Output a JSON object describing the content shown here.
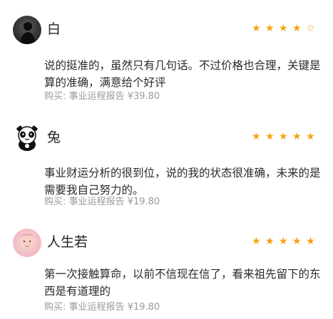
{
  "reviews": [
    {
      "username": "白",
      "rating": 4,
      "text": "说的挺准的，虽然只有几句话。不过价格也合理，关键是算的准确，满意给个好评",
      "purchase_label": "购买:",
      "product": "事业运程报告",
      "price": "¥39.80",
      "avatar_icon": "person-silhouette-avatar"
    },
    {
      "username": "兔",
      "rating": 5,
      "text": "事业财运分析的很到位，说的我的状态很准确，未来的是需要我自己努力的。",
      "purchase_label": "购买:",
      "product": "事业运程报告",
      "price": "¥19.80",
      "avatar_icon": "panda-avatar"
    },
    {
      "username": "人生若",
      "rating": 5,
      "text": "第一次接触算命，以前不信现在信了，看来祖先留下的东西是有道理的",
      "purchase_label": "购买:",
      "product": "事业运程报告",
      "price": "¥19.80",
      "avatar_icon": "baby-photo-avatar"
    }
  ],
  "icons": {
    "star_full": "★",
    "star_empty": "☆"
  },
  "colors": {
    "star": "#f5a30b",
    "meta_text": "#9a9a9a"
  }
}
